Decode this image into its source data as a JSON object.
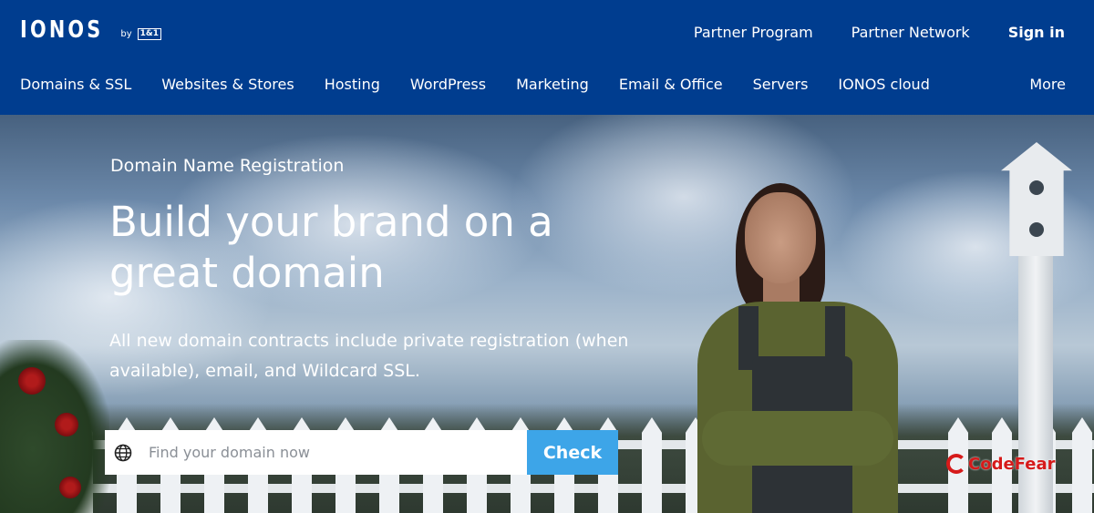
{
  "brand": {
    "logo": "IONOS",
    "by": "by",
    "parent": "1&1"
  },
  "top_links": {
    "partner_program": "Partner Program",
    "partner_network": "Partner Network",
    "sign_in": "Sign in"
  },
  "nav": {
    "items": [
      "Domains & SSL",
      "Websites & Stores",
      "Hosting",
      "WordPress",
      "Marketing",
      "Email & Office",
      "Servers",
      "IONOS cloud"
    ],
    "more": "More"
  },
  "hero": {
    "eyebrow": "Domain Name Registration",
    "headline": "Build your brand on a great domain",
    "subtext": "All new domain contracts include private registration (when available), email, and Wildcard SSL.",
    "search_placeholder": "Find your domain now",
    "search_value": "",
    "check_label": "Check"
  },
  "watermark": {
    "text": "CodeFear"
  },
  "colors": {
    "header_bg": "#003d8f",
    "check_button": "#3da5e8",
    "white": "#ffffff"
  },
  "icons": {
    "search": "globe-icon",
    "watermark": "codefear-logo-icon"
  }
}
